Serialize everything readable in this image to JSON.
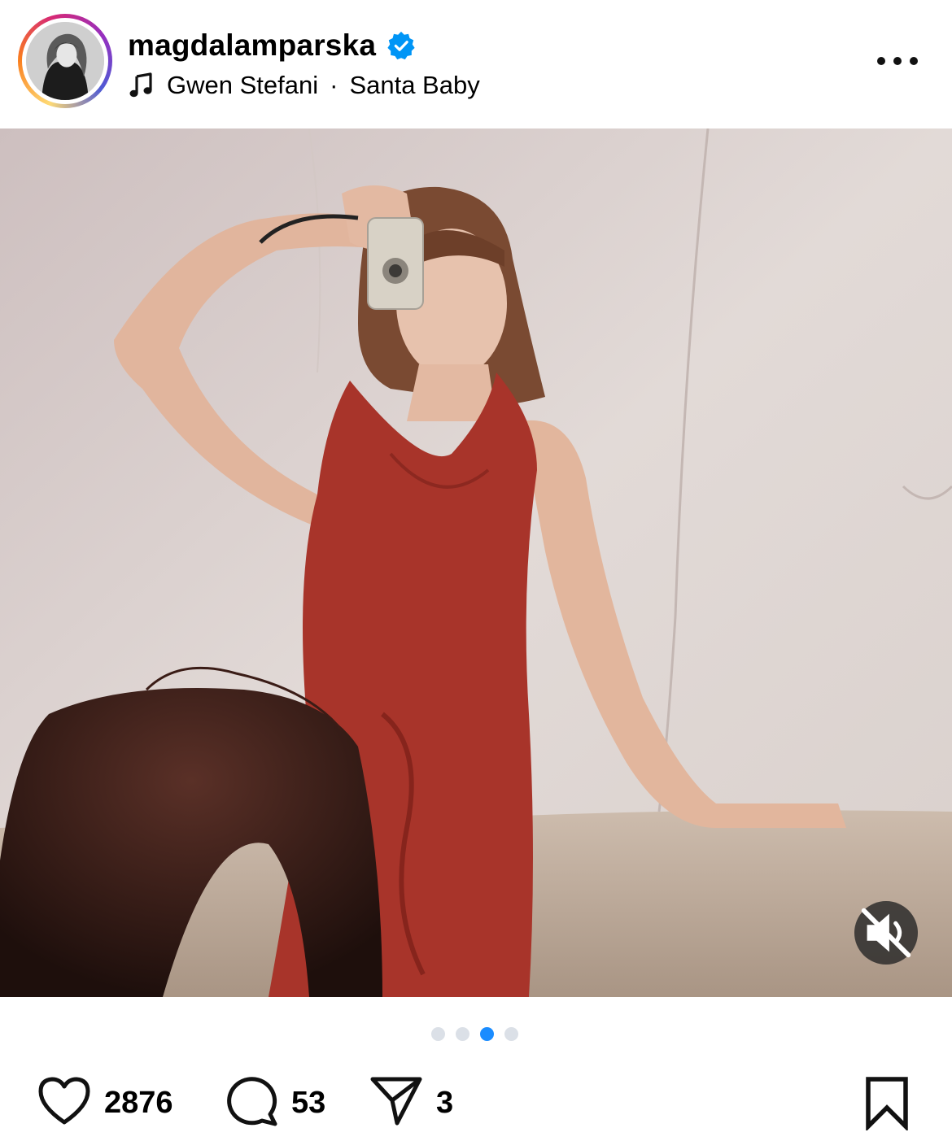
{
  "post": {
    "username": "magdalamparska",
    "verified": true,
    "music": {
      "artist": "Gwen Stefani",
      "separator": "·",
      "song": "Santa Baby"
    },
    "carousel": {
      "total": 4,
      "active_index": 3
    },
    "muted": true
  },
  "actions": {
    "likes": "2876",
    "comments": "53",
    "shares": "3"
  },
  "colors": {
    "verified_blue": "#0095f6",
    "dot_active": "#1a8cff",
    "dot_inactive": "#dbe0e7",
    "dress_red": "#a8342a"
  },
  "icons": [
    "verified-badge-icon",
    "music-note-icon",
    "more-options-icon",
    "mute-icon",
    "heart-icon",
    "comment-icon",
    "share-icon",
    "bookmark-icon"
  ]
}
